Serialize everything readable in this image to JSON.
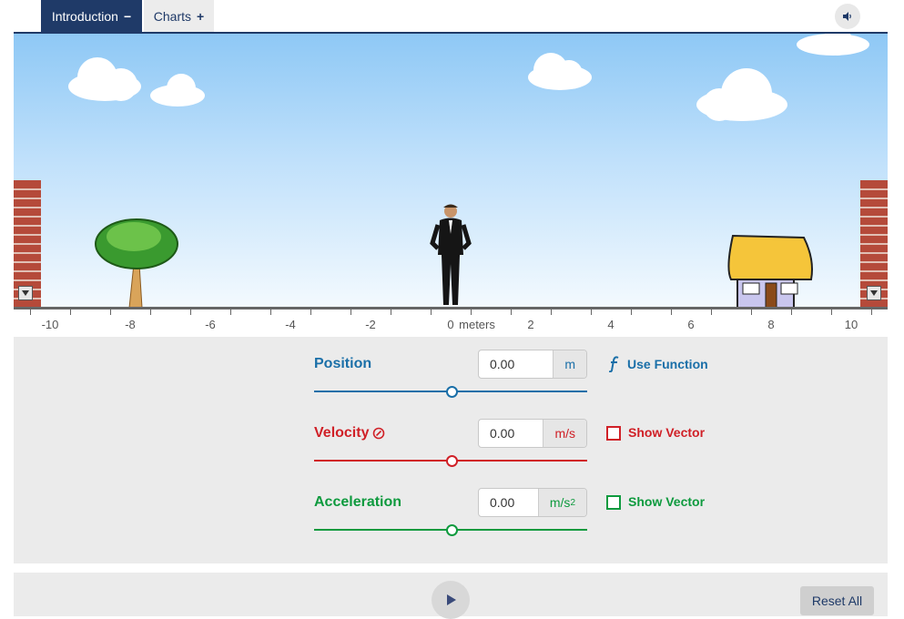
{
  "tabs": [
    {
      "label": "Introduction",
      "symbol": "−"
    },
    {
      "label": "Charts",
      "symbol": "+"
    }
  ],
  "sound_icon": "speaker-icon",
  "scene": {
    "axis_ticks": [
      "-10",
      "-8",
      "-6",
      "-4",
      "-2",
      "0",
      "2",
      "4",
      "6",
      "8",
      "10"
    ],
    "axis_unit": "meters",
    "man_position_m": 0
  },
  "controls": {
    "position": {
      "label": "Position",
      "value": "0.00",
      "unit": "m",
      "color": "#1a6fa8",
      "option": "Use Function",
      "option_icon": "function-icon"
    },
    "velocity": {
      "label": "Velocity",
      "value": "0.00",
      "unit": "m/s",
      "color": "#d02027",
      "option": "Show Vector",
      "label_icon": "dial-icon"
    },
    "acceleration": {
      "label": "Acceleration",
      "value": "0.00",
      "unit_base": "m/s",
      "unit_sup": "2",
      "color": "#0e9a3e",
      "option": "Show Vector"
    }
  },
  "bottom": {
    "play_icon": "play-icon",
    "reset_label": "Reset All"
  }
}
